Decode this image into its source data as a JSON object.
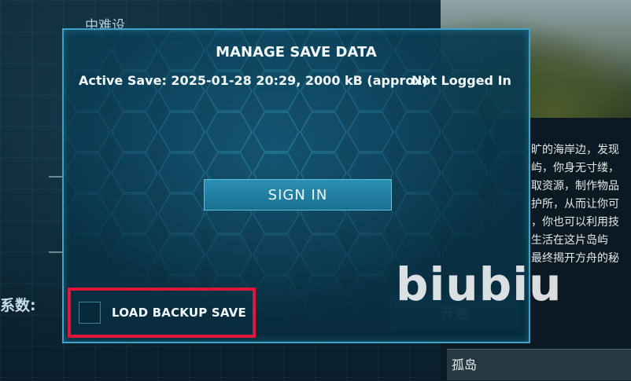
{
  "background": {
    "difficulty_label": "中难设",
    "coef_label": "系数:",
    "description_lines": [
      "旷的海岸边，发现",
      "屿，你身无寸缕，",
      "取资源，制作物品",
      "护所，从而让你可",
      "，你也可以利用技",
      "生活在这片岛屿",
      "最终揭开方舟的秘"
    ],
    "start_button": "开始",
    "map_name": "孤岛"
  },
  "modal": {
    "title": "MANAGE SAVE DATA",
    "active_save": "Active Save: 2025-01-28 20:29, 2000 kB (approx)",
    "login_status": "Not Logged In",
    "sign_in_button": "SIGN IN",
    "load_backup_label": "LOAD BACKUP SAVE",
    "load_backup_checked": false
  },
  "watermark": "biubiu",
  "colors": {
    "accent": "#3ea3c6",
    "highlight_box": "#e0173b",
    "button_fill": "#1c7090"
  }
}
